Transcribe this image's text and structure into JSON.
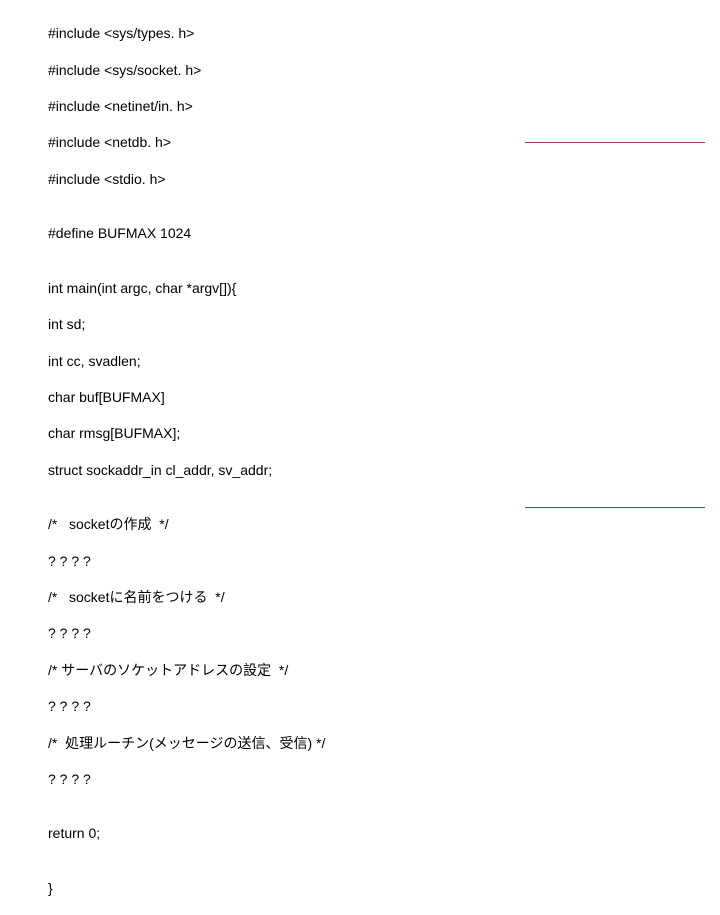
{
  "code": {
    "lines": [
      "#include <sys/types. h>",
      "#include <sys/socket. h>",
      "#include <netinet/in. h>",
      "#include <netdb. h>",
      "#include <stdio. h>",
      "",
      "#define BUFMAX 1024",
      "",
      "int main(int argc, char *argv[]){",
      "int sd;",
      "int cc, svadlen;",
      "char buf[BUFMAX]",
      "char rmsg[BUFMAX];",
      "struct sockaddr_in cl_addr, sv_addr;",
      "",
      "/*   socketの作成  */",
      "? ? ? ?",
      "/*   socketに名前をつける  */",
      "? ? ? ?",
      "/* サーバのソケットアドレスの設定  */",
      "? ? ? ?",
      "/*  処理ルーチン(メッセージの送信、受信) */",
      "? ? ? ?",
      "",
      "return 0;",
      "",
      "}"
    ]
  }
}
